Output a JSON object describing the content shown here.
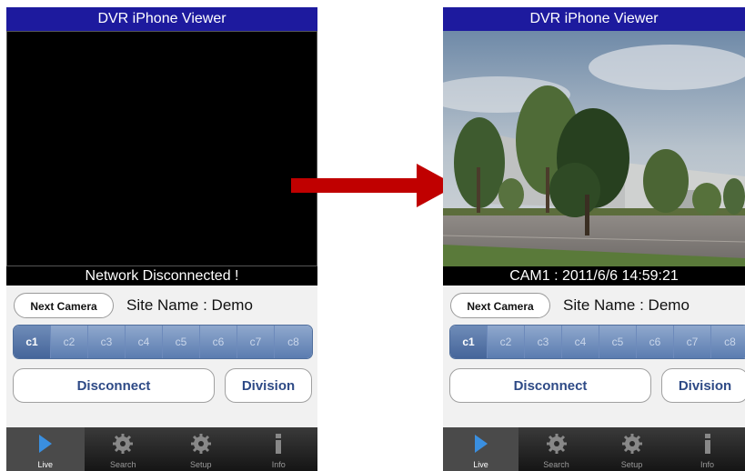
{
  "screens": [
    {
      "title": "DVR iPhone Viewer",
      "status": "Network Disconnected !",
      "next_camera": "Next Camera",
      "site_label": "Site Name :",
      "site_name": "Demo",
      "cameras": [
        "c1",
        "c2",
        "c3",
        "c4",
        "c5",
        "c6",
        "c7",
        "c8"
      ],
      "selected_camera": "c1",
      "disconnect": "Disconnect",
      "division": "Division",
      "tabs": [
        "Live",
        "Search",
        "Setup",
        "Info"
      ]
    },
    {
      "title": "DVR iPhone Viewer",
      "status": "CAM1 : 2011/6/6 14:59:21",
      "next_camera": "Next Camera",
      "site_label": "Site Name :",
      "site_name": "Demo",
      "cameras": [
        "c1",
        "c2",
        "c3",
        "c4",
        "c5",
        "c6",
        "c7",
        "c8"
      ],
      "selected_camera": "c1",
      "disconnect": "Disconnect",
      "division": "Division",
      "tabs": [
        "Live",
        "Search",
        "Setup",
        "Info"
      ]
    }
  ],
  "colors": {
    "title_bar": "#1d1a9e",
    "arrow": "#c00000",
    "button_text": "#2e4a86"
  }
}
